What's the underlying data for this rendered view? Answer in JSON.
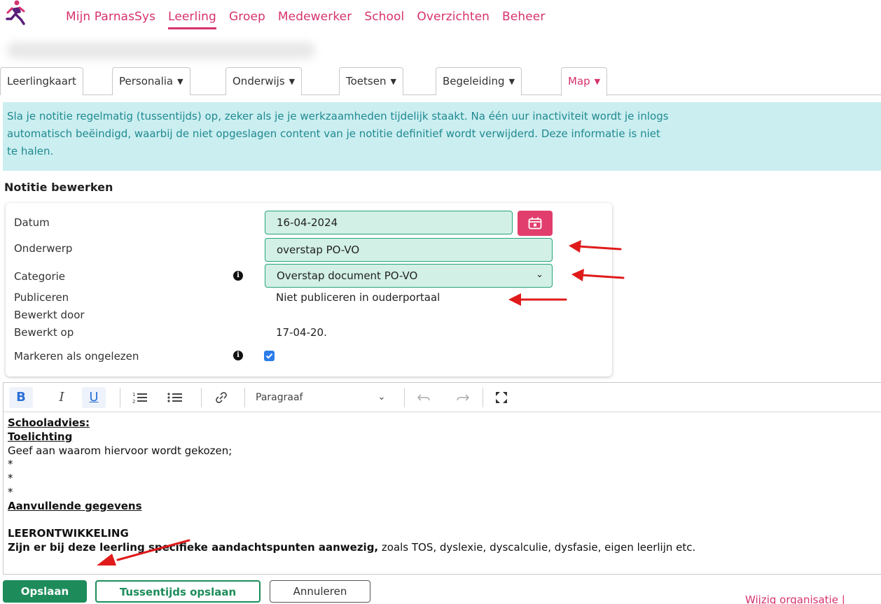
{
  "nav": {
    "items": [
      "Mijn ParnasSys",
      "Leerling",
      "Groep",
      "Medewerker",
      "School",
      "Overzichten",
      "Beheer"
    ],
    "active": "Leerling"
  },
  "tabs": [
    {
      "label": "Leerlingkaart",
      "caret": ""
    },
    {
      "label": "Personalia",
      "caret": "▼"
    },
    {
      "label": "Onderwijs",
      "caret": "▼"
    },
    {
      "label": "Toetsen",
      "caret": "▼"
    },
    {
      "label": "Begeleiding",
      "caret": "▼"
    },
    {
      "label": "Map",
      "caret": "▼"
    }
  ],
  "banner": {
    "line1": "Sla je notitie regelmatig (tussentijds) op, zeker als je je werkzaamheden tijdelijk staakt. Na één uur inactiviteit wordt je inlogs",
    "line2": "automatisch beëindigd, waarbij de niet opgeslagen content van je notitie definitief wordt verwijderd. Deze informatie is niet",
    "line3": "te halen."
  },
  "section_title": "Notitie bewerken",
  "form": {
    "datum_label": "Datum",
    "datum_value": "16-04-2024",
    "onderwerp_label": "Onderwerp",
    "onderwerp_value": "overstap PO-VO",
    "categorie_label": "Categorie",
    "categorie_value": "Overstap document PO-VO",
    "publiceren_label": "Publiceren",
    "publiceren_value": "Niet publiceren in ouderportaal",
    "bewerkt_door_label": "Bewerkt door",
    "bewerkt_op_label": "Bewerkt op",
    "bewerkt_op_value": "17-04-20.",
    "markeren_label": "Markeren als ongelezen",
    "markeren_checked": true
  },
  "toolbar": {
    "bold": "B",
    "italic": "I",
    "underline": "U",
    "paragraph": "Paragraaf"
  },
  "editor": {
    "line1": "Schooladvies:",
    "line2": "Toelichting",
    "line3": " Geef aan waarom hiervoor wordt gekozen;",
    "line4": "*",
    "line5": "*",
    "line6": "*",
    "line7": "Aanvullende gegevens",
    "line9": "LEERONTWIKKELING",
    "line10_bold": "Zijn er bij deze leerling specifieke aandachtspunten aanwezig,",
    "line10_rest": " zoals TOS, dyslexie, dyscalculie, dysfasie, eigen leerlijn etc."
  },
  "buttons": {
    "save": "Opslaan",
    "save_interim": "Tussentijds opslaan",
    "cancel": "Annuleren"
  },
  "org_link": "Wijzig organisatie |",
  "colors": {
    "brand": "#d6326e",
    "success": "#1d8c5a",
    "banner_bg": "#cbeef0",
    "field_bg": "#d2f0e5",
    "arrow": "#e01b1b"
  }
}
